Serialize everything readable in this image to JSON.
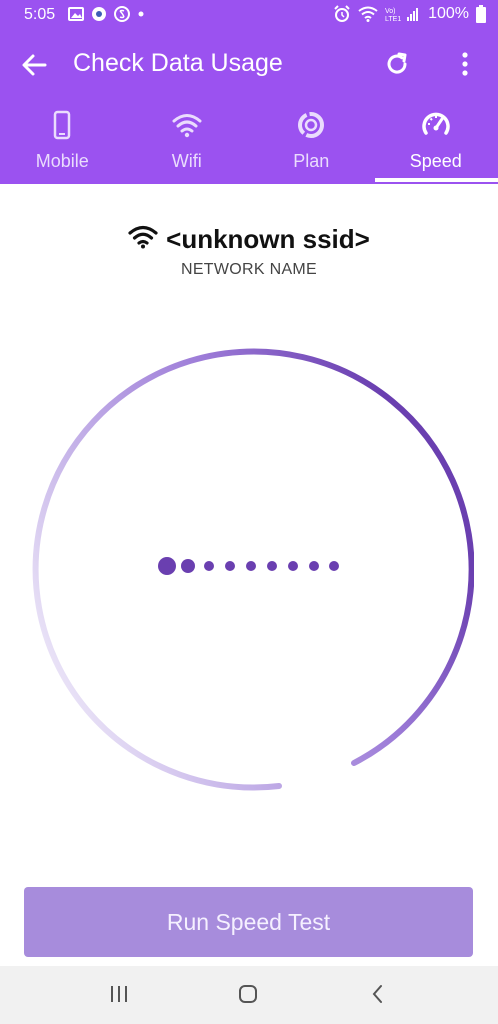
{
  "status_bar": {
    "time": "5:05",
    "battery": "100%",
    "icons_left": [
      "gallery-icon",
      "browser-icon",
      "skype-icon",
      "notification-dot-icon"
    ],
    "icons_right": [
      "alarm-icon",
      "wifi-icon",
      "lte-signal-icon",
      "battery-icon"
    ]
  },
  "app_bar": {
    "title": "Check Data Usage",
    "actions": [
      "back-icon",
      "refresh-icon",
      "more-vert-icon"
    ]
  },
  "tabs": [
    {
      "label": "Mobile",
      "icon": "smartphone-icon",
      "active": false
    },
    {
      "label": "Wifi",
      "icon": "wifi-icon",
      "active": false
    },
    {
      "label": "Plan",
      "icon": "plan-icon",
      "active": false
    },
    {
      "label": "Speed",
      "icon": "speedometer-icon",
      "active": true
    }
  ],
  "network": {
    "name": "<unknown ssid>",
    "label": "NETWORK NAME"
  },
  "action": {
    "run_label": "Run Speed Test"
  },
  "colors": {
    "primary": "#9b52f0",
    "accent": "#6a3fb0",
    "button_bg": "#a78cdc"
  }
}
